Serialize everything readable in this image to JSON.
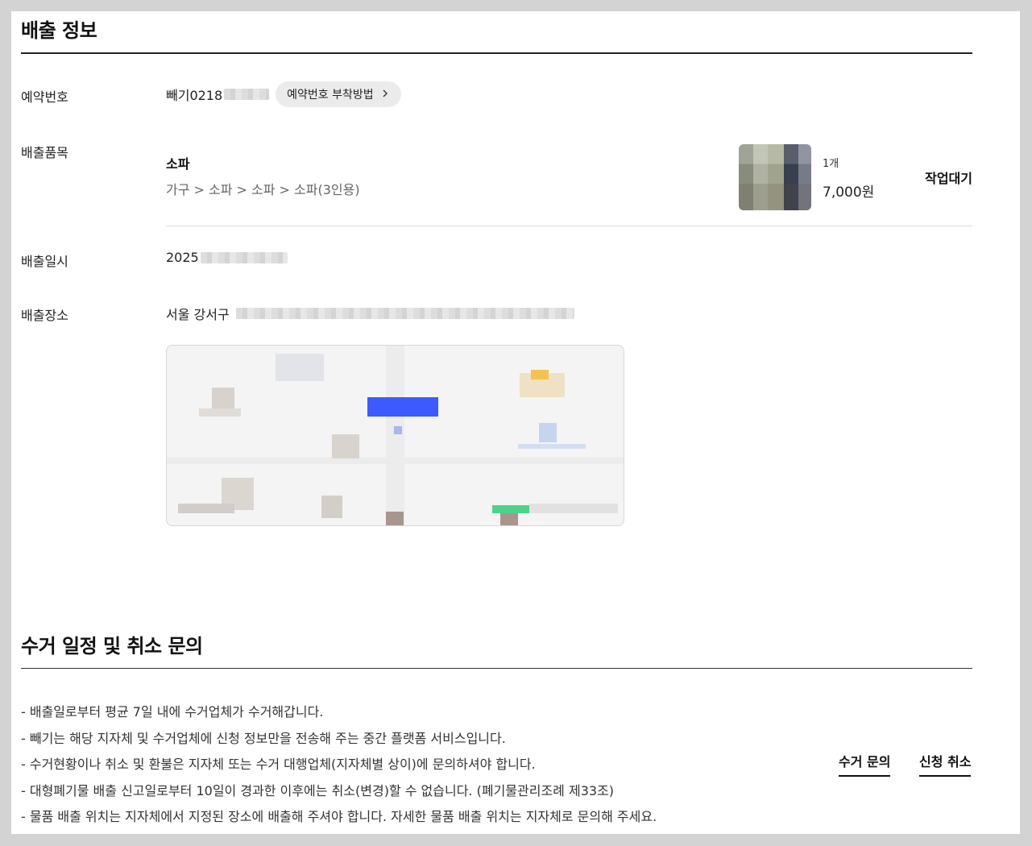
{
  "discharge_info": {
    "title": "배출 정보",
    "reservation": {
      "label": "예약번호",
      "value": "빼기0218",
      "attach_button": "예약번호 부착방법",
      "attach_button_icon": "chevron-right-icon"
    },
    "items": {
      "label": "배출품목",
      "name": "소파",
      "category_path": "가구 > 소파 > 소파 > 소파(3인용)",
      "quantity": "1개",
      "price": "7,000원",
      "status": "작업대기"
    },
    "datetime": {
      "label": "배출일시",
      "value": "2025"
    },
    "location": {
      "label": "배출장소",
      "value": "서울 강서구"
    }
  },
  "pickup": {
    "title": "수거 일정 및 취소 문의",
    "notices": [
      "- 배출일로부터 평균 7일 내에 수거업체가 수거해갑니다.",
      "- 빼기는 해당 지자체 및 수거업체에 신청 정보만을 전송해 주는 중간 플랫폼 서비스입니다.",
      "- 수거현황이나 취소 및 환불은 지자체 또는 수거 대행업체(지자체별 상이)에 문의하셔야 합니다.",
      "- 대형폐기물 배출 신고일로부터 10일이 경과한 이후에는 취소(변경)할 수 없습니다. (폐기물관리조례 제33조)",
      "- 물품 배출 위치는 지자체에서 지정된 장소에 배출해 주셔야 합니다. 자세한 물품 배출 위치는 지자체로 문의해 주세요."
    ],
    "inquiry_button": "수거 문의",
    "cancel_button": "신청 취소"
  },
  "colors": {
    "map_marker": "#3d5afe",
    "map_green": "#4cd28a",
    "map_yellow": "#f3c24f"
  }
}
